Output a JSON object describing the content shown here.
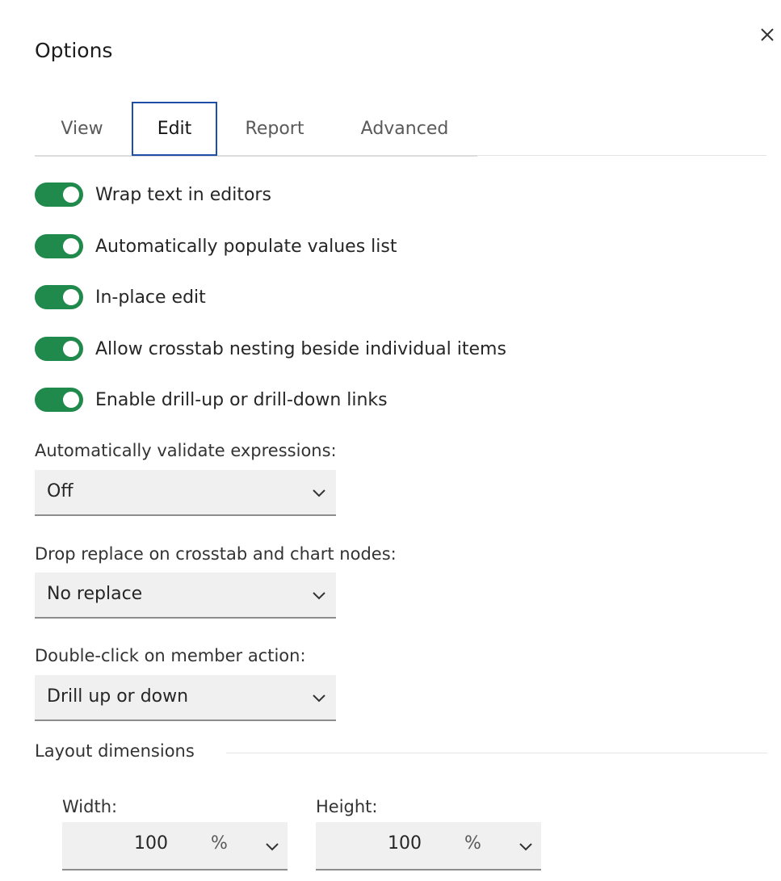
{
  "dialog": {
    "title": "Options",
    "close_icon": "close-icon"
  },
  "tabs": [
    {
      "label": "View",
      "active": false
    },
    {
      "label": "Edit",
      "active": true
    },
    {
      "label": "Report",
      "active": false
    },
    {
      "label": "Advanced",
      "active": false
    }
  ],
  "toggles": [
    {
      "label": "Wrap text in editors",
      "on": true
    },
    {
      "label": "Automatically populate values list",
      "on": true
    },
    {
      "label": "In-place edit",
      "on": true
    },
    {
      "label": "Allow crosstab nesting beside individual items",
      "on": true
    },
    {
      "label": "Enable drill-up or drill-down links",
      "on": true
    }
  ],
  "selects": [
    {
      "label": "Automatically validate expressions:",
      "value": "Off"
    },
    {
      "label": "Drop replace on crosstab and chart nodes:",
      "value": "No replace"
    },
    {
      "label": "Double-click on member action:",
      "value": "Drill up or down"
    }
  ],
  "layout_dimensions": {
    "title": "Layout dimensions",
    "width": {
      "label": "Width:",
      "value": "100",
      "unit": "%"
    },
    "height": {
      "label": "Height:",
      "value": "100",
      "unit": "%"
    }
  },
  "colors": {
    "toggle_on": "#1f8a4b",
    "tab_active_border": "#1f4ea8",
    "field_bg": "#f0f0f0"
  },
  "icons": {
    "chevron": "chevron-down-icon"
  }
}
